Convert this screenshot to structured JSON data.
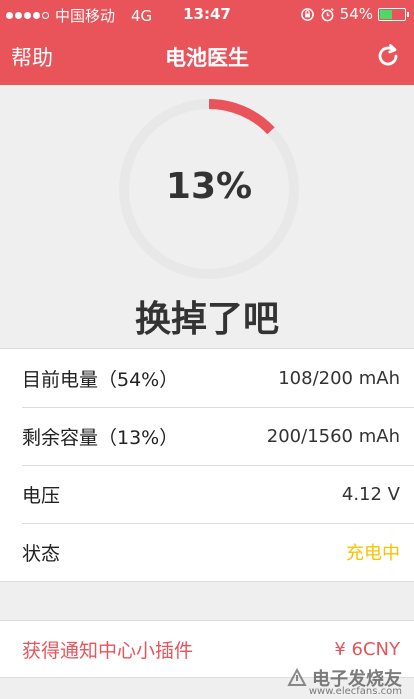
{
  "status_bar": {
    "carrier": "中国移动",
    "network": "4G",
    "time": "13:47",
    "battery_text": "54%",
    "battery_level": 0.54
  },
  "nav": {
    "help_label": "帮助",
    "title": "电池医生",
    "refresh_icon": "refresh-icon"
  },
  "gauge": {
    "percent_text": "13%",
    "value": 0.13,
    "accent": "#e9545b",
    "track": "#e8e8e8"
  },
  "verdict": "换掉了吧",
  "info_rows": [
    {
      "label": "目前电量（54%）",
      "value": "108/200 mAh"
    },
    {
      "label": "剩余容量（13%）",
      "value": "200/1560 mAh"
    },
    {
      "label": "电压",
      "value": "4.12 V"
    },
    {
      "label": "状态",
      "value": "充电中"
    }
  ],
  "plugin": {
    "label": "获得通知中心小插件",
    "price": "¥ 6CNY"
  },
  "watermark": {
    "text": "电子发烧友",
    "url": "www.elecfans.com"
  }
}
